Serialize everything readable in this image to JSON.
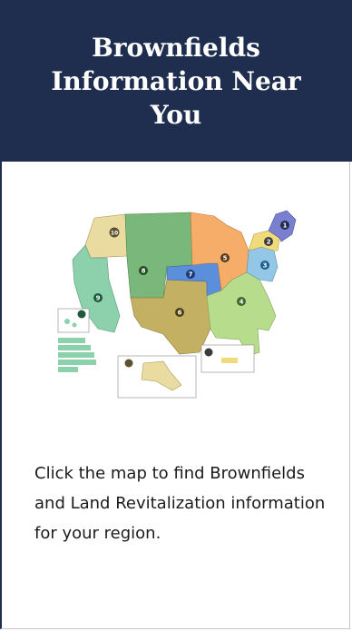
{
  "card": {
    "title": "Brownfields Information Near You",
    "caption": "Click the map to find Brownfields and Land Revitalization information for your region.",
    "header_color": "#1f2e4e",
    "map": {
      "icon": "us-epa-regions-map",
      "region_numbers": [
        "1",
        "2",
        "3",
        "4",
        "5",
        "6",
        "7",
        "8",
        "9",
        "10"
      ],
      "region_colors": {
        "1": "#7a7fd0",
        "2": "#efdb7a",
        "3": "#94c6e6",
        "4": "#b6dc8c",
        "5": "#f6ad6a",
        "6": "#c4b062",
        "7": "#5c8fdb",
        "8": "#7ab77a",
        "9": "#8cd1ab",
        "10": "#eadca0"
      }
    }
  }
}
